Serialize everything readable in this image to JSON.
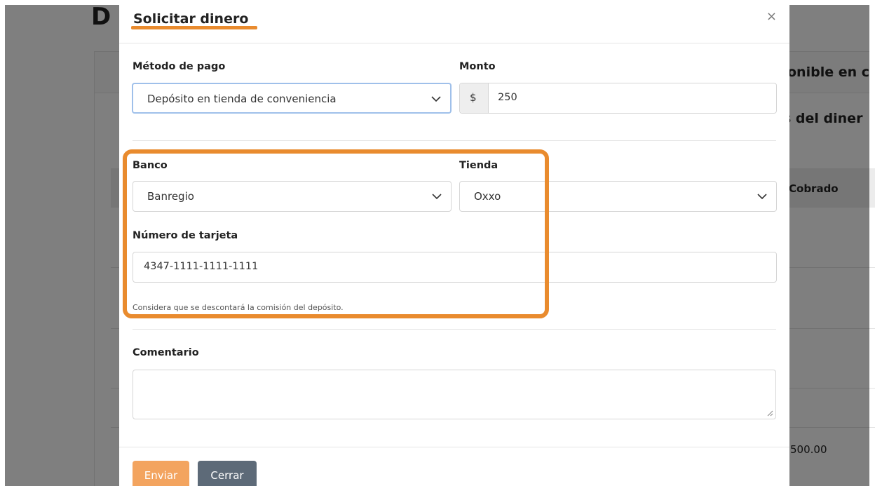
{
  "background": {
    "page_title": "D",
    "available_heading": "onible en c",
    "money_heading": "s del diner",
    "table_header": "Cobrado",
    "visible_cell": "500.00"
  },
  "modal": {
    "title": "Solicitar dinero",
    "close_symbol": "×",
    "payment_method": {
      "label": "Método de pago",
      "value": "Depósito en tienda de conveniencia"
    },
    "amount": {
      "label": "Monto",
      "currency": "$",
      "value": "250"
    },
    "bank": {
      "label": "Banco",
      "value": "Banregio"
    },
    "store": {
      "label": "Tienda",
      "value": "Oxxo"
    },
    "card_number": {
      "label": "Número de tarjeta",
      "value": "4347-1111-1111-1111"
    },
    "help_text": "Considera que se descontará la comisión del depósito.",
    "comment": {
      "label": "Comentario",
      "value": ""
    },
    "buttons": {
      "send": "Enviar",
      "close": "Cerrar"
    }
  },
  "colors": {
    "highlight": "#e98b2e",
    "send_button": "#f3a45f",
    "close_button": "#5d6a78",
    "overlay": "rgba(0,0,0,0.5)"
  }
}
